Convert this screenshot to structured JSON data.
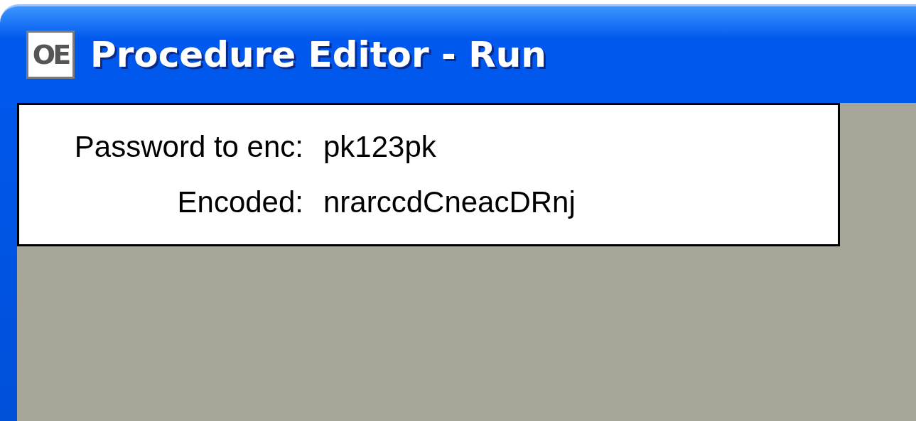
{
  "window": {
    "title": "Procedure Editor - Run",
    "icon_text": "OE"
  },
  "fields": [
    {
      "label": "Password to enc:",
      "value": "pk123pk"
    },
    {
      "label": "Encoded:",
      "value": "nrarccdCneacDRnj"
    }
  ]
}
